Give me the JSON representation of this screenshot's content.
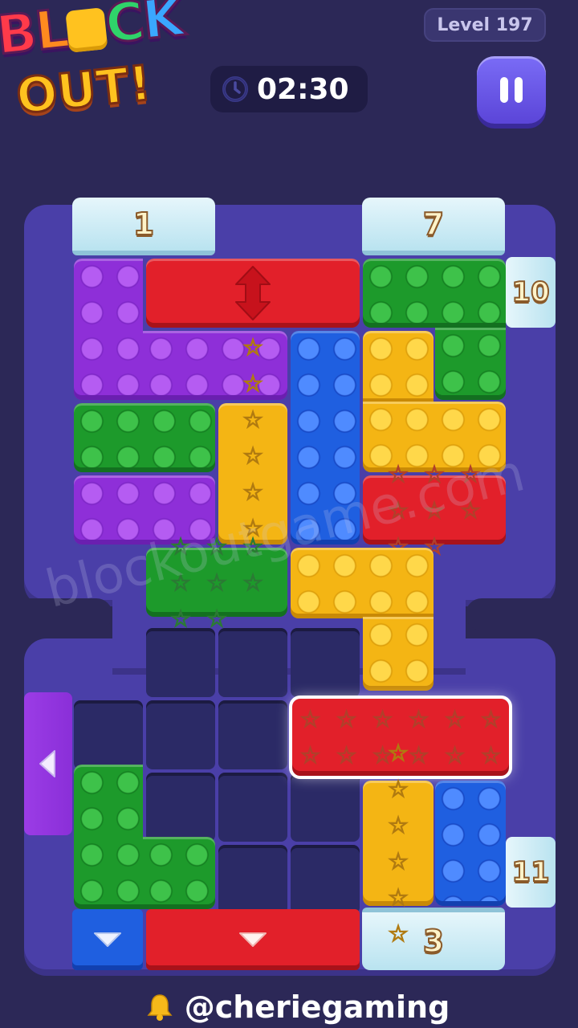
{
  "app": {
    "logo_top": "BLOCK",
    "logo_bottom": "OUT!"
  },
  "header": {
    "level_label": "Level 197",
    "timer": "02:30",
    "pause_icon": "pause-icon",
    "clock_icon": "clock-icon"
  },
  "doors": {
    "top_left": "1",
    "top_right": "7",
    "right_upper": "10",
    "right_lower": "11",
    "bottom_right": "3"
  },
  "colors": {
    "purple": "#8e2fd8",
    "green": "#1d9a2b",
    "blue": "#1f5fe0",
    "yellow": "#f4b514",
    "red": "#e2202a",
    "board": "#4a3fa8"
  },
  "watermark": "blockoutgame.com",
  "credit": {
    "handle": "@cheriegaming",
    "icon": "bell-icon"
  }
}
